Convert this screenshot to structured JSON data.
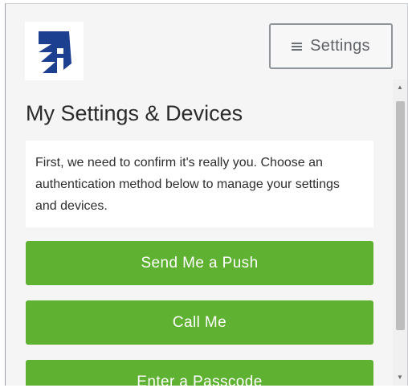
{
  "header": {
    "logo_icon": "brand-logo-icon",
    "settings_label": "Settings",
    "settings_icon": "hamburger-menu-icon"
  },
  "main": {
    "title": "My Settings & Devices",
    "instructions": "First, we need to confirm it's really you. Choose an authentication method below to manage your settings and devices."
  },
  "actions": {
    "push_label": "Send Me a Push",
    "call_label": "Call Me",
    "passcode_label": "Enter a Passcode"
  },
  "colors": {
    "button_green": "#5fb132",
    "logo_blue": "#1d3f8f"
  }
}
